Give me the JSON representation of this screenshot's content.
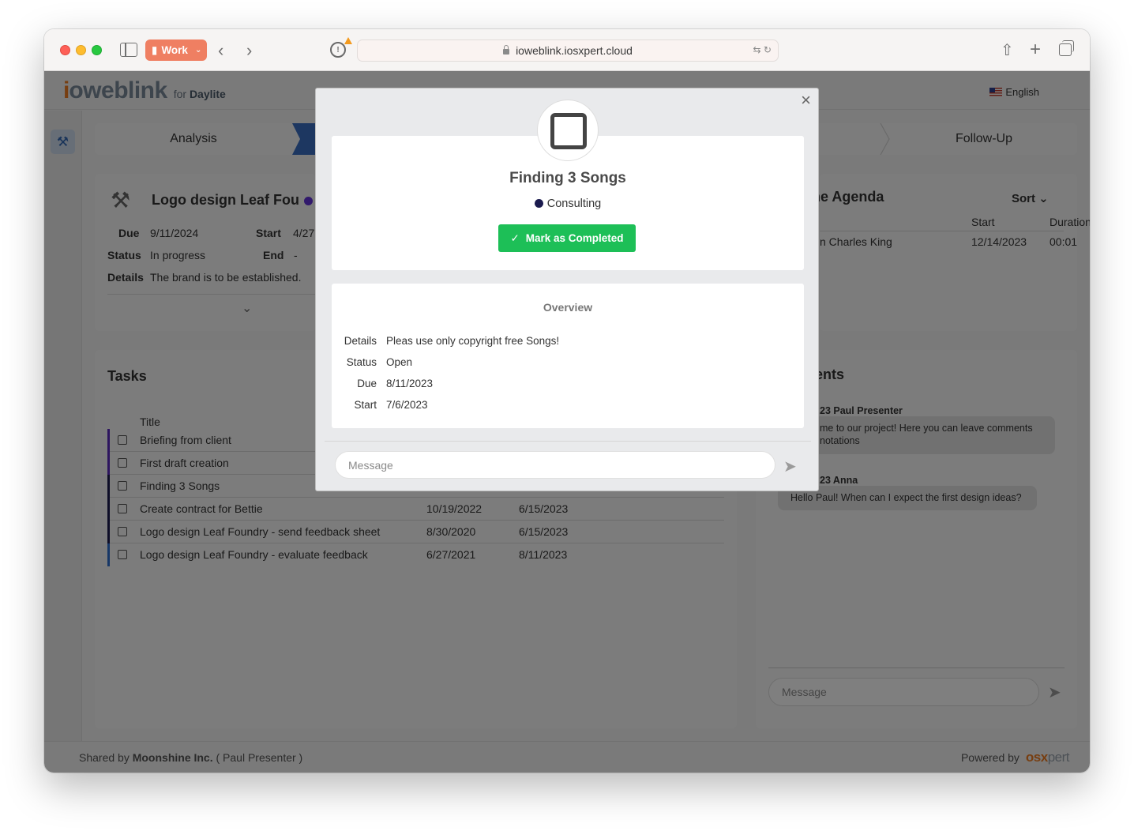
{
  "browser": {
    "tab_group": "Work",
    "url": "ioweblink.iosxpert.cloud"
  },
  "header": {
    "logo_mark": "i",
    "logo_text": "oweblink",
    "logo_for": "for",
    "logo_for_product": "Daylite",
    "language": "English"
  },
  "steps": {
    "step1": "Analysis",
    "step_last": "Follow-Up"
  },
  "project": {
    "title": "Logo design Leaf Fou",
    "due_label": "Due",
    "due_value": "9/11/2024",
    "start_label": "Start",
    "start_value": "4/27",
    "status_label": "Status",
    "status_value": "In progress",
    "end_label": "End",
    "end_value": "-",
    "details_label": "Details",
    "details_value": "The brand is to be established."
  },
  "agenda": {
    "title_partial": "ne Agenda",
    "sort_label": "Sort",
    "col_start": "Start",
    "col_duration": "Duration",
    "row_name": "n Charles King",
    "row_start": "12/14/2023",
    "row_duration": "00:01"
  },
  "tasks": {
    "title": "Tasks",
    "col_title": "Title",
    "rows": [
      {
        "title": "Briefing from client",
        "d1": "",
        "d2": "",
        "color": "#5b2bbf"
      },
      {
        "title": "First draft creation",
        "d1": "",
        "d2": "",
        "color": "#5b2bbf"
      },
      {
        "title": "Finding 3 Songs",
        "d1": "",
        "d2": "",
        "color": "#1a1a4e"
      },
      {
        "title": "Create contract for Bettie",
        "d1": "10/19/2022",
        "d2": "6/15/2023",
        "color": "#1a1a4e"
      },
      {
        "title": "Logo design Leaf Foundry - send feedback sheet",
        "d1": "8/30/2020",
        "d2": "6/15/2023",
        "color": "#1a1a4e"
      },
      {
        "title": "Logo design Leaf Foundry - evaluate feedback",
        "d1": "6/27/2021",
        "d2": "8/11/2023",
        "color": "#2f6fcf"
      }
    ]
  },
  "comments": {
    "title_partial": "ents",
    "c1_author": "23 Paul Presenter",
    "c1_text_line1": "me to our project! Here you can leave comments",
    "c1_text_line2": "notations",
    "c2_author": "23 Anna",
    "c2_text": "Hello Paul! When can I expect the first design ideas?",
    "message_placeholder": "Message"
  },
  "footer": {
    "shared_by": "Shared by",
    "company": "Moonshine Inc.",
    "person": "( Paul Presenter )",
    "powered_by": "Powered by",
    "brand_mark": "osx",
    "brand_rest": "pert"
  },
  "modal": {
    "title": "Finding 3 Songs",
    "category": "Consulting",
    "category_color": "#1a1a4e",
    "complete_button": "Mark as Completed",
    "overview_title": "Overview",
    "details_label": "Details",
    "details_value": "Pleas use only copyright free Songs!",
    "status_label": "Status",
    "status_value": "Open",
    "due_label": "Due",
    "due_value": "8/11/2023",
    "start_label": "Start",
    "start_value": "7/6/2023",
    "message_placeholder": "Message"
  }
}
